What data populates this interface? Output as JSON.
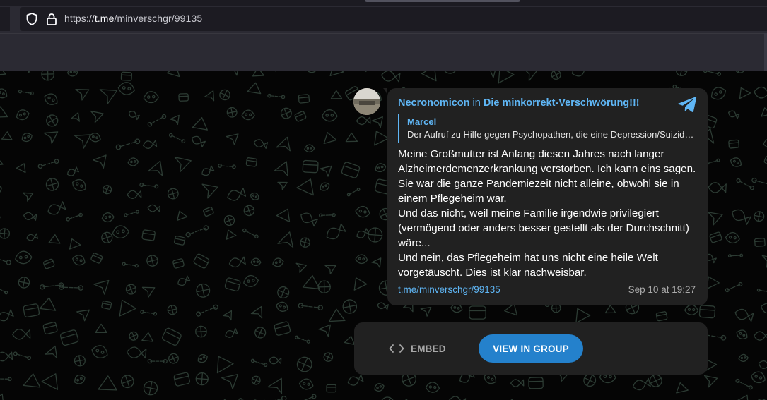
{
  "browser": {
    "url_scheme": "https://",
    "url_host": "t.me",
    "url_path": "/minverschgr/99135"
  },
  "post": {
    "author": "Necronomicon",
    "in_word": "in",
    "group": "Die minkorrekt-Verschwörung!!!",
    "reply": {
      "name": "Marcel",
      "text": "Der Aufruf zu Hilfe gegen Psychopathen, die eine Depression/Suizid herbeiführen wollen"
    },
    "text": "Meine Großmutter ist Anfang diesen Jahres nach langer Alzheimerdemenzerkrankung verstorben. Ich kann eins sagen. Sie war die ganze Pandemiezeit nicht alleine, obwohl sie in einem Pflegeheim war.\nUnd das nicht, weil meine Familie irgendwie privilegiert (vermögend oder anders besser gestellt als der Durchschnitt) wäre...\nUnd nein, das Pflegeheim hat uns nicht eine heile Welt vorgetäuscht. Dies ist klar nachweisbar.",
    "link": "t.me/minverschgr/99135",
    "date": "Sep 10 at 19:27"
  },
  "actions": {
    "embed_label": "EMBED",
    "view_label": "VIEW IN GROUP"
  },
  "colors": {
    "accent": "#5fb6f5",
    "button": "#2481cc",
    "bubble": "#212121",
    "doodle": "#2c3b33"
  },
  "icons": [
    "shield-icon",
    "lock-icon",
    "telegram-icon",
    "code-icon"
  ]
}
